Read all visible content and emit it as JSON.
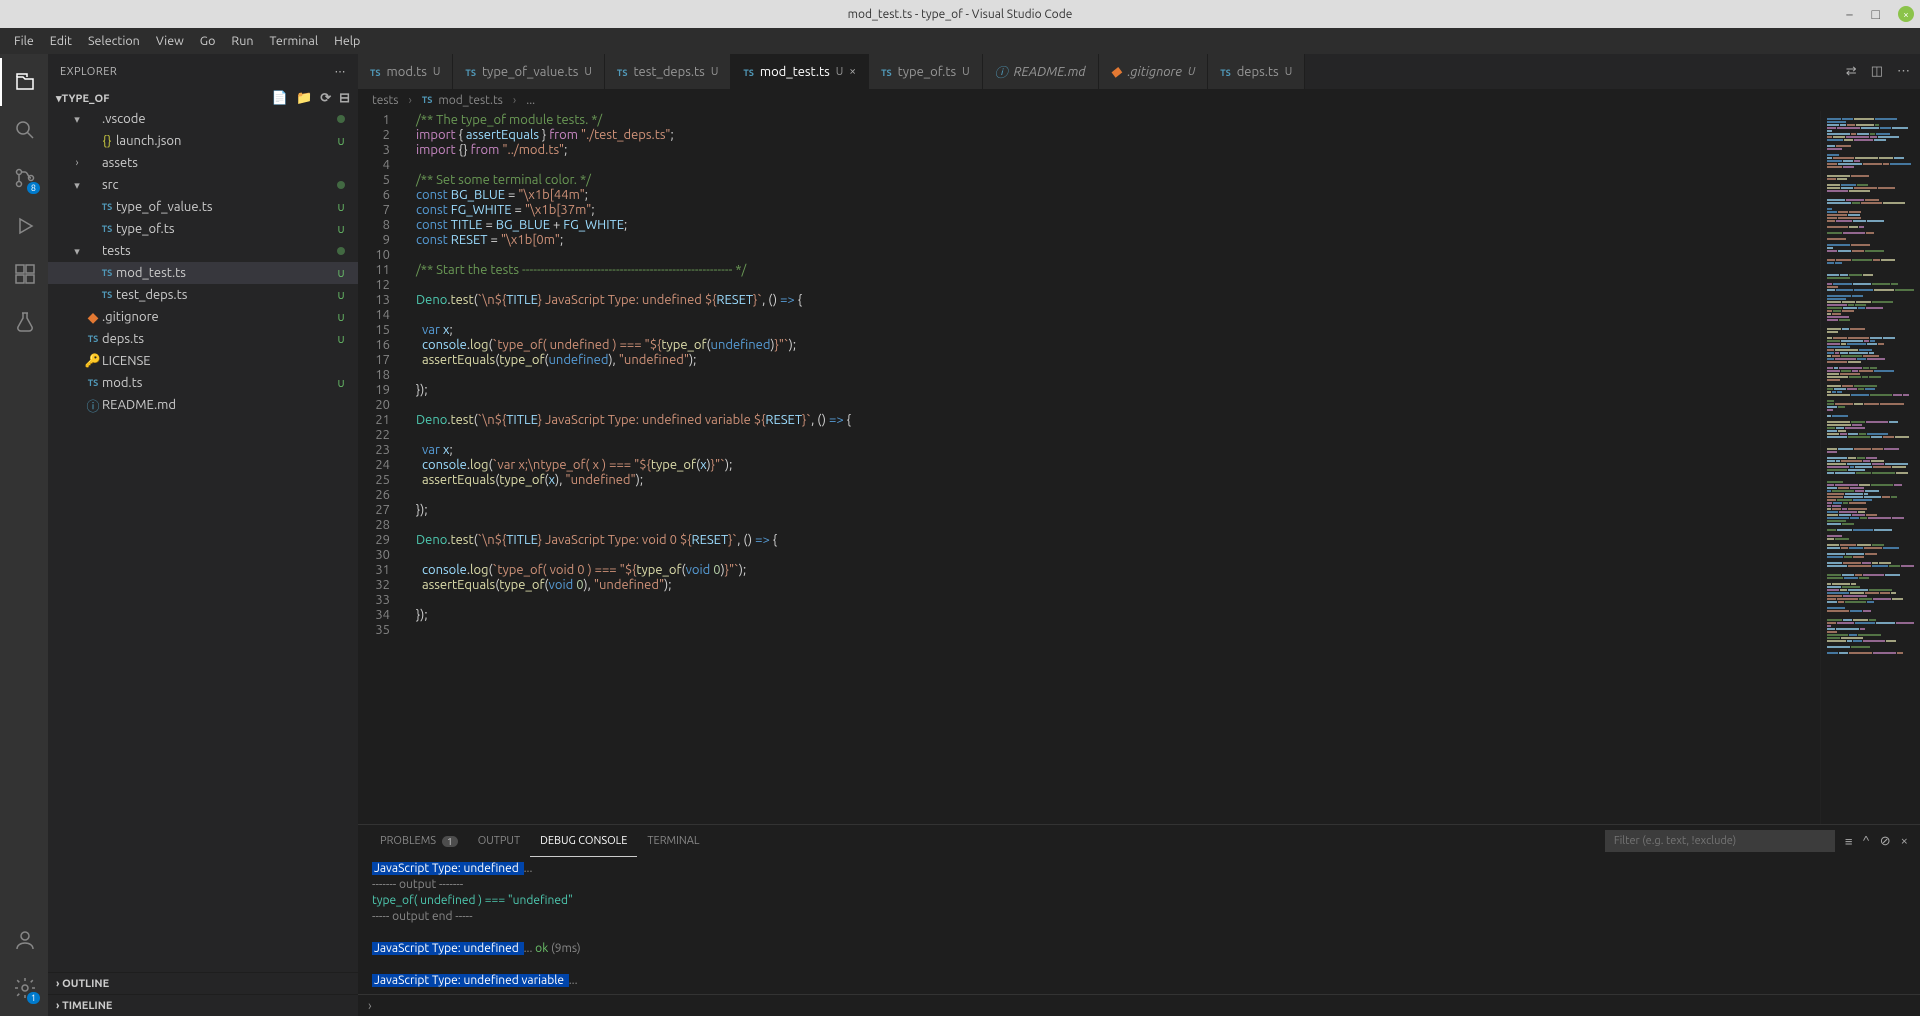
{
  "window": {
    "title": "mod_test.ts - type_of - Visual Studio Code"
  },
  "menu": [
    "File",
    "Edit",
    "Selection",
    "View",
    "Go",
    "Run",
    "Terminal",
    "Help"
  ],
  "sidebar": {
    "header": "EXPLORER",
    "root": "TYPE_OF",
    "tree": [
      {
        "depth": 1,
        "chev": "▾",
        "name": ".vscode",
        "mark": "dot"
      },
      {
        "depth": 2,
        "icon": "json",
        "name": "launch.json",
        "mark": "U"
      },
      {
        "depth": 1,
        "chev": "›",
        "name": "assets"
      },
      {
        "depth": 1,
        "chev": "▾",
        "name": "src",
        "mark": "dot"
      },
      {
        "depth": 2,
        "icon": "ts",
        "name": "type_of_value.ts",
        "mark": "U"
      },
      {
        "depth": 2,
        "icon": "ts",
        "name": "type_of.ts",
        "mark": "U"
      },
      {
        "depth": 1,
        "chev": "▾",
        "name": "tests",
        "mark": "dot"
      },
      {
        "depth": 2,
        "icon": "ts",
        "name": "mod_test.ts",
        "mark": "U",
        "active": true
      },
      {
        "depth": 2,
        "icon": "ts",
        "name": "test_deps.ts",
        "mark": "U"
      },
      {
        "depth": 1,
        "icon": "git",
        "name": ".gitignore",
        "mark": "U"
      },
      {
        "depth": 1,
        "icon": "ts",
        "name": "deps.ts",
        "mark": "U"
      },
      {
        "depth": 1,
        "icon": "lic",
        "name": "LICENSE"
      },
      {
        "depth": 1,
        "icon": "ts",
        "name": "mod.ts",
        "mark": "U"
      },
      {
        "depth": 1,
        "icon": "md",
        "name": "README.md"
      }
    ],
    "outline": "OUTLINE",
    "timeline": "TIMELINE"
  },
  "tabs": [
    {
      "icon": "ts",
      "label": "mod.ts",
      "dirty": "U"
    },
    {
      "icon": "ts",
      "label": "type_of_value.ts",
      "dirty": "U"
    },
    {
      "icon": "ts",
      "label": "test_deps.ts",
      "dirty": "U"
    },
    {
      "icon": "ts",
      "label": "mod_test.ts",
      "dirty": "U",
      "active": true,
      "close": true
    },
    {
      "icon": "ts",
      "label": "type_of.ts",
      "dirty": "U"
    },
    {
      "icon": "md",
      "label": "README.md",
      "modified": true
    },
    {
      "icon": "git",
      "label": ".gitignore",
      "dirty": "U",
      "modified": true
    },
    {
      "icon": "ts",
      "label": "deps.ts",
      "dirty": "U"
    }
  ],
  "breadcrumb": [
    "tests",
    "mod_test.ts",
    "..."
  ],
  "panel": {
    "tabs": {
      "problems": "PROBLEMS",
      "problems_count": "1",
      "output": "OUTPUT",
      "debug": "DEBUG CONSOLE",
      "terminal": "TERMINAL"
    },
    "filter_placeholder": "Filter (e.g. text, !exclude)",
    "body": [
      {
        "type": "title",
        "text": " JavaScript Type: undefined ",
        "suffix": " ..."
      },
      {
        "type": "grey",
        "text": "------- output -------"
      },
      {
        "type": "teal",
        "text": "type_of( undefined ) === \"undefined\""
      },
      {
        "type": "grey",
        "text": "----- output end -----"
      },
      {
        "type": "blank",
        "text": ""
      },
      {
        "type": "title-ok",
        "text": " JavaScript Type: undefined ",
        "suffix": " ... ",
        "ok": "ok",
        "time": " (9ms)"
      },
      {
        "type": "blank",
        "text": ""
      },
      {
        "type": "title",
        "text": " JavaScript Type: undefined variable ",
        "suffix": " ..."
      }
    ],
    "prompt": "›"
  },
  "code_lines": 35
}
